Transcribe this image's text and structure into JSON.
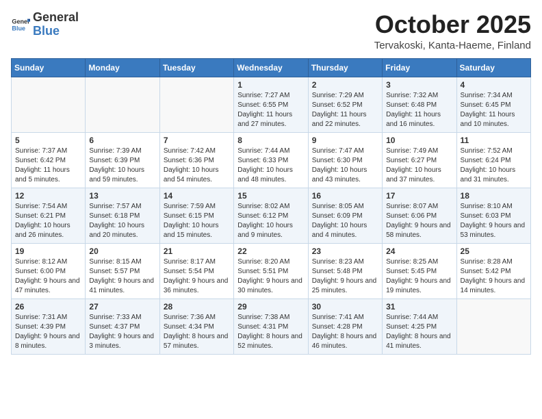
{
  "header": {
    "logo_general": "General",
    "logo_blue": "Blue",
    "month_title": "October 2025",
    "location": "Tervakoski, Kanta-Haeme, Finland"
  },
  "days_of_week": [
    "Sunday",
    "Monday",
    "Tuesday",
    "Wednesday",
    "Thursday",
    "Friday",
    "Saturday"
  ],
  "weeks": [
    [
      {
        "day": "",
        "sunrise": "",
        "sunset": "",
        "daylight": ""
      },
      {
        "day": "",
        "sunrise": "",
        "sunset": "",
        "daylight": ""
      },
      {
        "day": "",
        "sunrise": "",
        "sunset": "",
        "daylight": ""
      },
      {
        "day": "1",
        "sunrise": "Sunrise: 7:27 AM",
        "sunset": "Sunset: 6:55 PM",
        "daylight": "Daylight: 11 hours and 27 minutes."
      },
      {
        "day": "2",
        "sunrise": "Sunrise: 7:29 AM",
        "sunset": "Sunset: 6:52 PM",
        "daylight": "Daylight: 11 hours and 22 minutes."
      },
      {
        "day": "3",
        "sunrise": "Sunrise: 7:32 AM",
        "sunset": "Sunset: 6:48 PM",
        "daylight": "Daylight: 11 hours and 16 minutes."
      },
      {
        "day": "4",
        "sunrise": "Sunrise: 7:34 AM",
        "sunset": "Sunset: 6:45 PM",
        "daylight": "Daylight: 11 hours and 10 minutes."
      }
    ],
    [
      {
        "day": "5",
        "sunrise": "Sunrise: 7:37 AM",
        "sunset": "Sunset: 6:42 PM",
        "daylight": "Daylight: 11 hours and 5 minutes."
      },
      {
        "day": "6",
        "sunrise": "Sunrise: 7:39 AM",
        "sunset": "Sunset: 6:39 PM",
        "daylight": "Daylight: 10 hours and 59 minutes."
      },
      {
        "day": "7",
        "sunrise": "Sunrise: 7:42 AM",
        "sunset": "Sunset: 6:36 PM",
        "daylight": "Daylight: 10 hours and 54 minutes."
      },
      {
        "day": "8",
        "sunrise": "Sunrise: 7:44 AM",
        "sunset": "Sunset: 6:33 PM",
        "daylight": "Daylight: 10 hours and 48 minutes."
      },
      {
        "day": "9",
        "sunrise": "Sunrise: 7:47 AM",
        "sunset": "Sunset: 6:30 PM",
        "daylight": "Daylight: 10 hours and 43 minutes."
      },
      {
        "day": "10",
        "sunrise": "Sunrise: 7:49 AM",
        "sunset": "Sunset: 6:27 PM",
        "daylight": "Daylight: 10 hours and 37 minutes."
      },
      {
        "day": "11",
        "sunrise": "Sunrise: 7:52 AM",
        "sunset": "Sunset: 6:24 PM",
        "daylight": "Daylight: 10 hours and 31 minutes."
      }
    ],
    [
      {
        "day": "12",
        "sunrise": "Sunrise: 7:54 AM",
        "sunset": "Sunset: 6:21 PM",
        "daylight": "Daylight: 10 hours and 26 minutes."
      },
      {
        "day": "13",
        "sunrise": "Sunrise: 7:57 AM",
        "sunset": "Sunset: 6:18 PM",
        "daylight": "Daylight: 10 hours and 20 minutes."
      },
      {
        "day": "14",
        "sunrise": "Sunrise: 7:59 AM",
        "sunset": "Sunset: 6:15 PM",
        "daylight": "Daylight: 10 hours and 15 minutes."
      },
      {
        "day": "15",
        "sunrise": "Sunrise: 8:02 AM",
        "sunset": "Sunset: 6:12 PM",
        "daylight": "Daylight: 10 hours and 9 minutes."
      },
      {
        "day": "16",
        "sunrise": "Sunrise: 8:05 AM",
        "sunset": "Sunset: 6:09 PM",
        "daylight": "Daylight: 10 hours and 4 minutes."
      },
      {
        "day": "17",
        "sunrise": "Sunrise: 8:07 AM",
        "sunset": "Sunset: 6:06 PM",
        "daylight": "Daylight: 9 hours and 58 minutes."
      },
      {
        "day": "18",
        "sunrise": "Sunrise: 8:10 AM",
        "sunset": "Sunset: 6:03 PM",
        "daylight": "Daylight: 9 hours and 53 minutes."
      }
    ],
    [
      {
        "day": "19",
        "sunrise": "Sunrise: 8:12 AM",
        "sunset": "Sunset: 6:00 PM",
        "daylight": "Daylight: 9 hours and 47 minutes."
      },
      {
        "day": "20",
        "sunrise": "Sunrise: 8:15 AM",
        "sunset": "Sunset: 5:57 PM",
        "daylight": "Daylight: 9 hours and 41 minutes."
      },
      {
        "day": "21",
        "sunrise": "Sunrise: 8:17 AM",
        "sunset": "Sunset: 5:54 PM",
        "daylight": "Daylight: 9 hours and 36 minutes."
      },
      {
        "day": "22",
        "sunrise": "Sunrise: 8:20 AM",
        "sunset": "Sunset: 5:51 PM",
        "daylight": "Daylight: 9 hours and 30 minutes."
      },
      {
        "day": "23",
        "sunrise": "Sunrise: 8:23 AM",
        "sunset": "Sunset: 5:48 PM",
        "daylight": "Daylight: 9 hours and 25 minutes."
      },
      {
        "day": "24",
        "sunrise": "Sunrise: 8:25 AM",
        "sunset": "Sunset: 5:45 PM",
        "daylight": "Daylight: 9 hours and 19 minutes."
      },
      {
        "day": "25",
        "sunrise": "Sunrise: 8:28 AM",
        "sunset": "Sunset: 5:42 PM",
        "daylight": "Daylight: 9 hours and 14 minutes."
      }
    ],
    [
      {
        "day": "26",
        "sunrise": "Sunrise: 7:31 AM",
        "sunset": "Sunset: 4:39 PM",
        "daylight": "Daylight: 9 hours and 8 minutes."
      },
      {
        "day": "27",
        "sunrise": "Sunrise: 7:33 AM",
        "sunset": "Sunset: 4:37 PM",
        "daylight": "Daylight: 9 hours and 3 minutes."
      },
      {
        "day": "28",
        "sunrise": "Sunrise: 7:36 AM",
        "sunset": "Sunset: 4:34 PM",
        "daylight": "Daylight: 8 hours and 57 minutes."
      },
      {
        "day": "29",
        "sunrise": "Sunrise: 7:38 AM",
        "sunset": "Sunset: 4:31 PM",
        "daylight": "Daylight: 8 hours and 52 minutes."
      },
      {
        "day": "30",
        "sunrise": "Sunrise: 7:41 AM",
        "sunset": "Sunset: 4:28 PM",
        "daylight": "Daylight: 8 hours and 46 minutes."
      },
      {
        "day": "31",
        "sunrise": "Sunrise: 7:44 AM",
        "sunset": "Sunset: 4:25 PM",
        "daylight": "Daylight: 8 hours and 41 minutes."
      },
      {
        "day": "",
        "sunrise": "",
        "sunset": "",
        "daylight": ""
      }
    ]
  ]
}
